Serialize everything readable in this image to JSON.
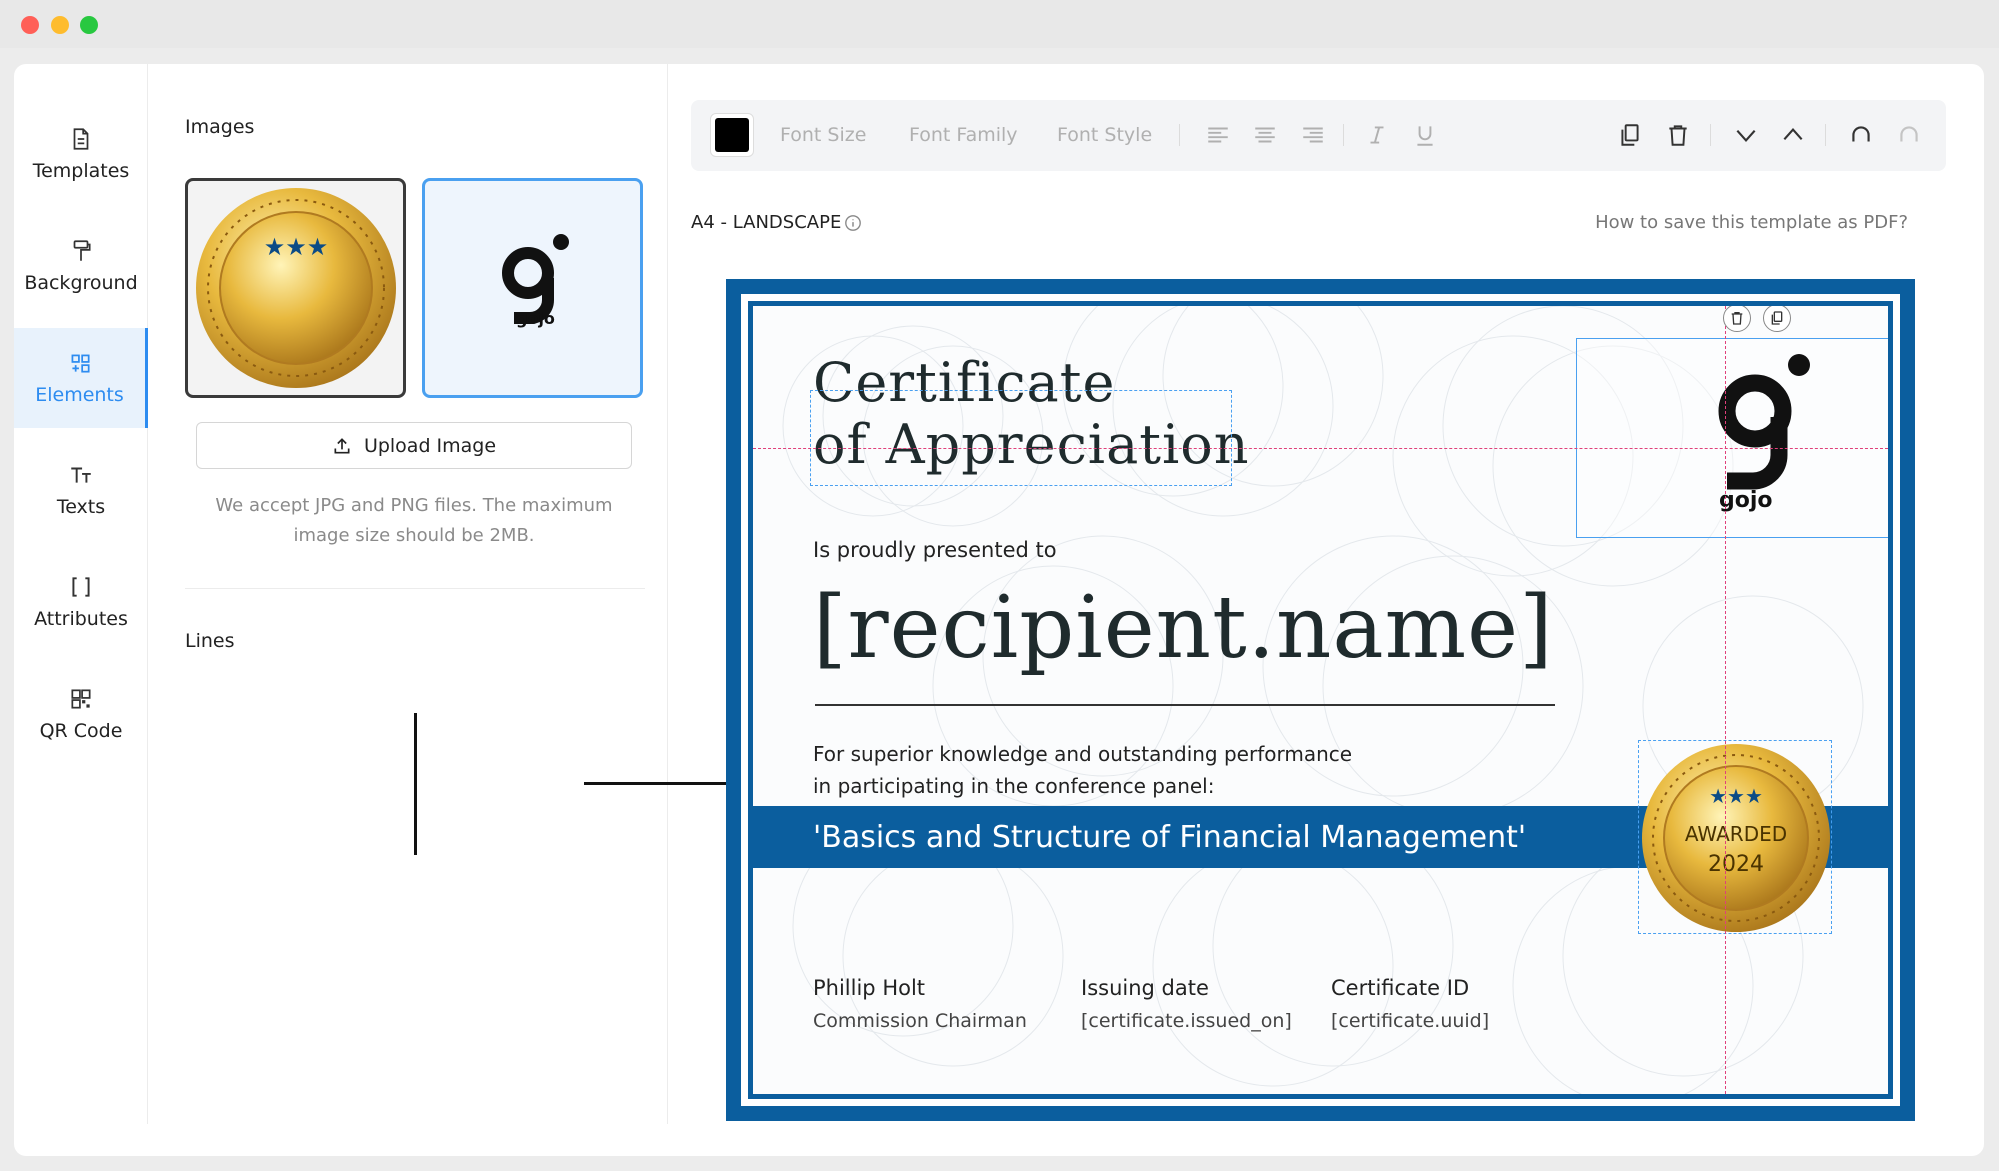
{
  "window": {
    "title": ""
  },
  "nav": {
    "items": [
      {
        "label": "Templates",
        "icon": "file-icon"
      },
      {
        "label": "Background",
        "icon": "paint-roller-icon"
      },
      {
        "label": "Elements",
        "icon": "grid-plus-icon",
        "active": true
      },
      {
        "label": "Texts",
        "icon": "text-size-icon"
      },
      {
        "label": "Attributes",
        "icon": "brackets-icon"
      },
      {
        "label": "QR Code",
        "icon": "qr-code-icon"
      }
    ]
  },
  "panel": {
    "images_title": "Images",
    "images": [
      {
        "kind": "gold-seal-stars",
        "selected": false
      },
      {
        "kind": "gojo-logo",
        "logo_text": "gojo",
        "selected": true
      }
    ],
    "upload_label": "Upload Image",
    "upload_hint": "We accept JPG and PNG files. The maximum image size should be 2MB.",
    "lines_title": "Lines"
  },
  "toolbar": {
    "color": "#000000",
    "font_size": "Font Size",
    "font_family": "Font Family",
    "font_style": "Font Style"
  },
  "canvas": {
    "size_label": "A4 - LANDSCAPE",
    "help_link": "How to save this template as PDF?"
  },
  "certificate": {
    "title_line1": "Certificate",
    "title_line2": "of Appreciation",
    "presented": "Is proudly presented to",
    "recipient": "[recipient.name]",
    "desc_line1": "For superior knowledge and outstanding performance",
    "desc_line2": "in participating in the conference panel:",
    "banner": "'Basics and Structure of Financial Management'",
    "logo_text": "gojo",
    "seal_line1": "AWARDED",
    "seal_line2": "2024",
    "signatories": [
      {
        "title": "Phillip Holt",
        "subtitle": "Commission Chairman"
      },
      {
        "title": "Issuing date",
        "subtitle": "[certificate.issued_on]"
      },
      {
        "title": "Certificate ID",
        "subtitle": "[certificate.uuid]"
      }
    ],
    "brand_color": "#0b5e9e",
    "guide_color": "#e0407a",
    "selection_color": "#4aa0f0"
  }
}
